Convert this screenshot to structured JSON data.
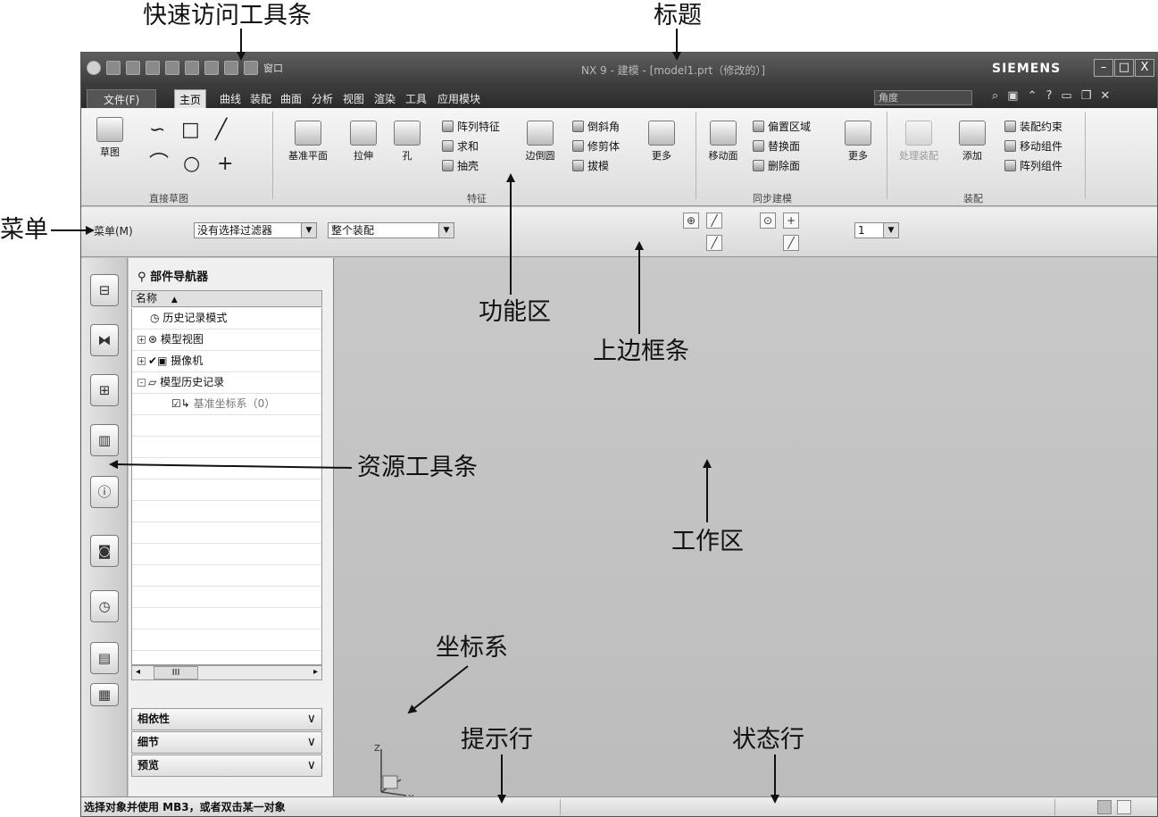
{
  "annotations": {
    "quick_access": "快速访问工具条",
    "title": "标题",
    "menu": "菜单",
    "function_area": "功能区",
    "top_border_bar": "上边框条",
    "resource_bar": "资源工具条",
    "work_area": "工作区",
    "coord_system": "坐标系",
    "prompt_line": "提示行",
    "status_line": "状态行"
  },
  "window": {
    "title": "NX 9 - 建模 - [model1.prt（修改的）]",
    "brand": "SIEMENS",
    "qat_window_label": "窗口",
    "controls": {
      "minimize": "–",
      "maximize": "□",
      "close": "X"
    }
  },
  "tabs": [
    "文件(F)",
    "主页",
    "曲线",
    "装配",
    "曲面",
    "分析",
    "视图",
    "渲染",
    "工具",
    "应用模块"
  ],
  "ribbon": {
    "search_value": "角度",
    "sketch": {
      "label": "草图",
      "group": "直接草图"
    },
    "feature": {
      "datum_plane": "基准平面",
      "extrude": "拉伸",
      "hole": "孔",
      "pattern": "阵列特征",
      "unite": "求和",
      "shell": "抽壳",
      "edge_blend": "边倒圆",
      "chamfer": "倒斜角",
      "trim_body": "修剪体",
      "draft": "拔模",
      "more": "更多",
      "group": "特征"
    },
    "sync": {
      "move_face": "移动面",
      "offset_region": "偏置区域",
      "replace_face": "替换面",
      "delete_face": "删除面",
      "more": "更多",
      "group": "同步建模"
    },
    "assembly": {
      "process": "处理装配",
      "add": "添加",
      "constraint": "装配约束",
      "move_comp": "移动组件",
      "pattern_comp": "阵列组件",
      "group": "装配"
    }
  },
  "border_bar": {
    "menu": "菜单(M)",
    "filter": "没有选择过滤器",
    "scope": "整个装配",
    "layer_value": "1"
  },
  "navigator": {
    "title": "部件导航器",
    "column": "名称",
    "items": [
      {
        "label": "历史记录模式"
      },
      {
        "label": "模型视图"
      },
      {
        "label": "摄像机"
      },
      {
        "label": "模型历史记录"
      },
      {
        "label": "基准坐标系（0）"
      }
    ],
    "scroll_thumb": "III",
    "panels": [
      "相依性",
      "细节",
      "预览"
    ]
  },
  "axes": {
    "z": "Z",
    "x": "X"
  },
  "status": {
    "prompt": "选择对象并使用 MB3，或者双击某一对象"
  }
}
